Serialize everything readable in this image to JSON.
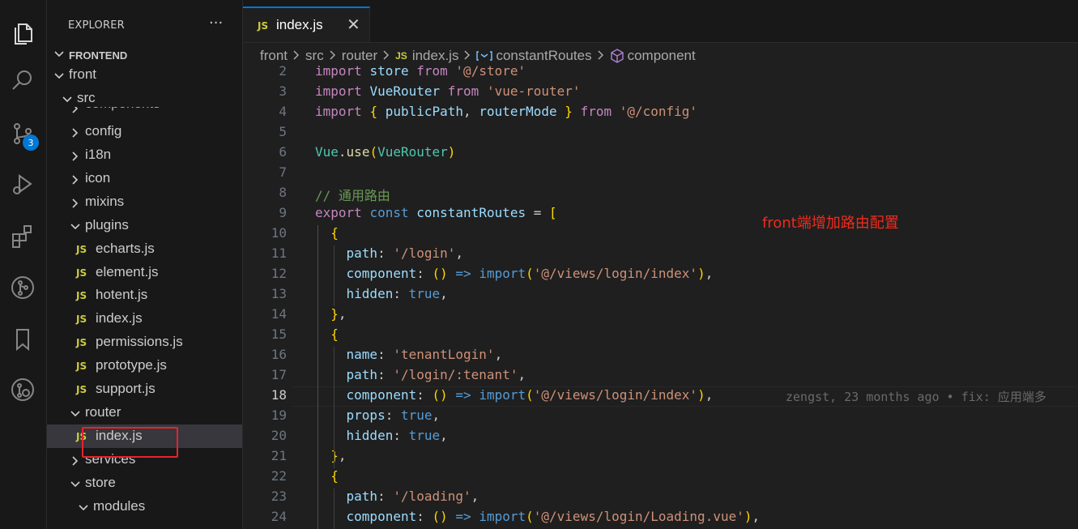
{
  "activity_bar": {
    "icons": [
      "explorer-icon",
      "search-icon",
      "source-control-icon",
      "run-debug-icon",
      "extensions-icon",
      "git-graph-icon",
      "bookmarks-icon",
      "timeline-icon"
    ],
    "source_control_badge": "3"
  },
  "sidebar": {
    "title": "EXPLORER",
    "more": "···",
    "section": "FRONTEND",
    "tree": [
      {
        "name": "front",
        "type": "folder",
        "open": true,
        "depth": 1
      },
      {
        "name": "src",
        "type": "folder",
        "open": true,
        "depth": 2
      },
      {
        "name": "components",
        "type": "folder",
        "open": false,
        "depth": 3
      },
      {
        "name": "config",
        "type": "folder",
        "open": false,
        "depth": 3
      },
      {
        "name": "i18n",
        "type": "folder",
        "open": false,
        "depth": 3
      },
      {
        "name": "icon",
        "type": "folder",
        "open": false,
        "depth": 3
      },
      {
        "name": "mixins",
        "type": "folder",
        "open": false,
        "depth": 3
      },
      {
        "name": "plugins",
        "type": "folder",
        "open": true,
        "depth": 3
      },
      {
        "name": "echarts.js",
        "type": "js",
        "depth": 4
      },
      {
        "name": "element.js",
        "type": "js",
        "depth": 4
      },
      {
        "name": "hotent.js",
        "type": "js",
        "depth": 4
      },
      {
        "name": "index.js",
        "type": "js",
        "depth": 4
      },
      {
        "name": "permissions.js",
        "type": "js",
        "depth": 4
      },
      {
        "name": "prototype.js",
        "type": "js",
        "depth": 4
      },
      {
        "name": "support.js",
        "type": "js",
        "depth": 4
      },
      {
        "name": "router",
        "type": "folder",
        "open": true,
        "depth": 3
      },
      {
        "name": "index.js",
        "type": "js",
        "depth": 4,
        "selected": true
      },
      {
        "name": "services",
        "type": "folder",
        "open": false,
        "depth": 3
      },
      {
        "name": "store",
        "type": "folder",
        "open": true,
        "depth": 3
      },
      {
        "name": "modules",
        "type": "folder",
        "open": true,
        "depth": 4
      }
    ]
  },
  "editor": {
    "tab": {
      "badge": "JS",
      "name": "index.js",
      "close": "✕"
    },
    "breadcrumb": [
      {
        "text": "front"
      },
      {
        "text": "src"
      },
      {
        "text": "router"
      },
      {
        "text": "index.js",
        "badge": "JS"
      },
      {
        "text": "constantRoutes",
        "icon": "variable-icon"
      },
      {
        "text": "component",
        "icon": "property-icon"
      }
    ],
    "active_line": "18",
    "lines": [
      {
        "n": "2",
        "code": "import store from '@/store'"
      },
      {
        "n": "3",
        "code": "import VueRouter from 'vue-router'"
      },
      {
        "n": "4",
        "code": "import { publicPath, routerMode } from '@/config'"
      },
      {
        "n": "5",
        "code": ""
      },
      {
        "n": "6",
        "code": "Vue.use(VueRouter)"
      },
      {
        "n": "7",
        "code": ""
      },
      {
        "n": "8",
        "code": "// 通用路由"
      },
      {
        "n": "9",
        "code": "export const constantRoutes = ["
      },
      {
        "n": "10",
        "code": "  {"
      },
      {
        "n": "11",
        "code": "    path: '/login',"
      },
      {
        "n": "12",
        "code": "    component: () => import('@/views/login/index'),"
      },
      {
        "n": "13",
        "code": "    hidden: true,"
      },
      {
        "n": "14",
        "code": "  },"
      },
      {
        "n": "15",
        "code": "  {"
      },
      {
        "n": "16",
        "code": "    name: 'tenantLogin',"
      },
      {
        "n": "17",
        "code": "    path: '/login/:tenant',"
      },
      {
        "n": "18",
        "code": "    component: () => import('@/views/login/index'),"
      },
      {
        "n": "19",
        "code": "    props: true,"
      },
      {
        "n": "20",
        "code": "    hidden: true,"
      },
      {
        "n": "21",
        "code": "  },"
      },
      {
        "n": "22",
        "code": "  {"
      },
      {
        "n": "23",
        "code": "    path: '/loading',"
      },
      {
        "n": "24",
        "code": "    component: () => import('@/views/login/Loading.vue'),"
      }
    ],
    "blame": "zengst, 23 months ago • fix: 应用端多",
    "annotation": "front端增加路由配置"
  },
  "colors": {
    "keyword": "#c586c0",
    "storage": "#569cd6",
    "variable": "#9cdcfe",
    "function": "#dcdcaa",
    "type": "#4ec9b0",
    "string": "#ce9178",
    "comment": "#6a9955",
    "bracket1": "#ffd700",
    "bracket2": "#da70d6",
    "bracket3": "#179fff",
    "js_badge": "#cbcb41",
    "accent": "#0078d4",
    "annotation": "#f02b1d"
  }
}
